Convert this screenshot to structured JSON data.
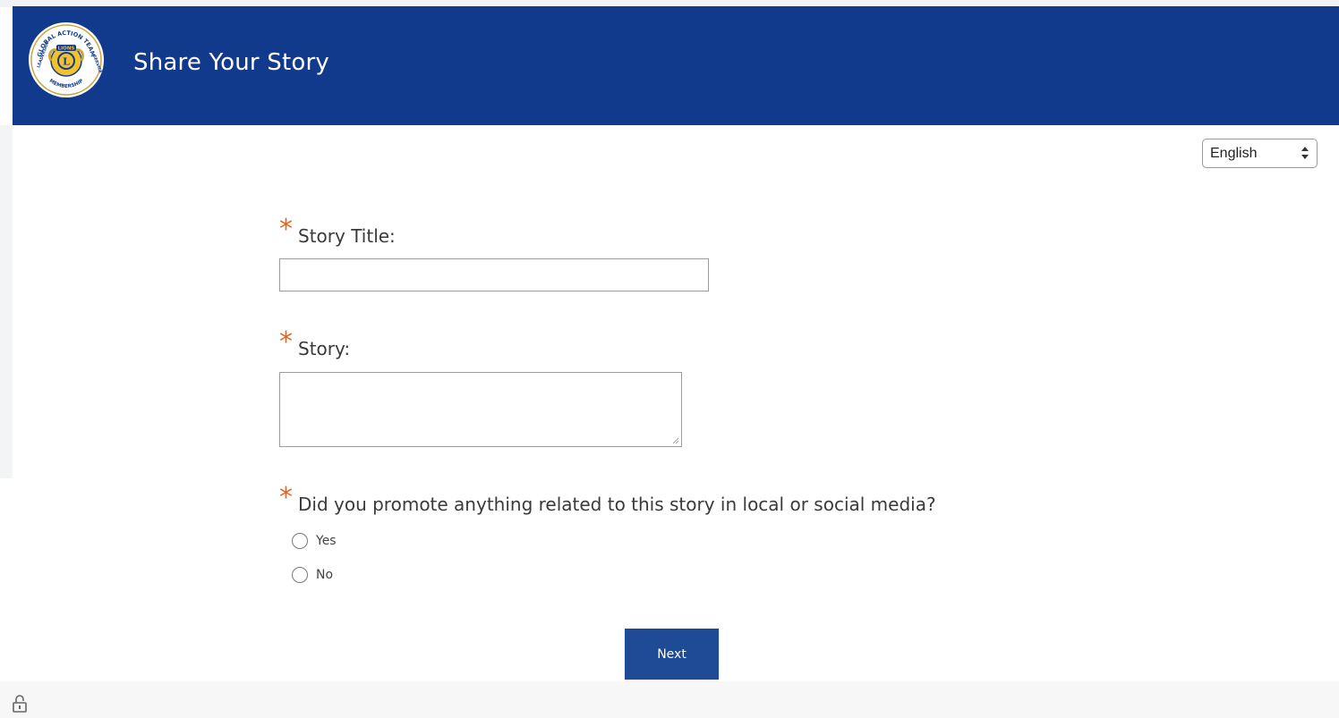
{
  "header": {
    "title": "Share Your Story",
    "background_color": "#123a8c",
    "logo": {
      "icon": "lions-global-action-team-logo",
      "ring_text_top": "GLOBAL ACTION TEAM",
      "ring_text_left": "LEADERSHIP",
      "ring_text_bottom": "MEMBERSHIP",
      "ring_text_right": "SERVICE",
      "emblem_text": "LIONS",
      "emblem_letter": "L"
    }
  },
  "language_select": {
    "selected": "English",
    "icon": "select-arrows-icon"
  },
  "form": {
    "required_color": "#e2661b",
    "questions": [
      {
        "required_mark": "*",
        "label": "Story Title:",
        "type": "text",
        "value": ""
      },
      {
        "required_mark": "*",
        "label": "Story:",
        "type": "textarea",
        "value": ""
      },
      {
        "required_mark": "*",
        "label": "Did you promote anything related to this story in local or social media?",
        "type": "radio",
        "options": [
          "Yes",
          "No"
        ],
        "selected": null
      }
    ],
    "next_label": "Next",
    "button_color": "#1f4a96"
  },
  "footer": {
    "icon": "lock-icon"
  }
}
